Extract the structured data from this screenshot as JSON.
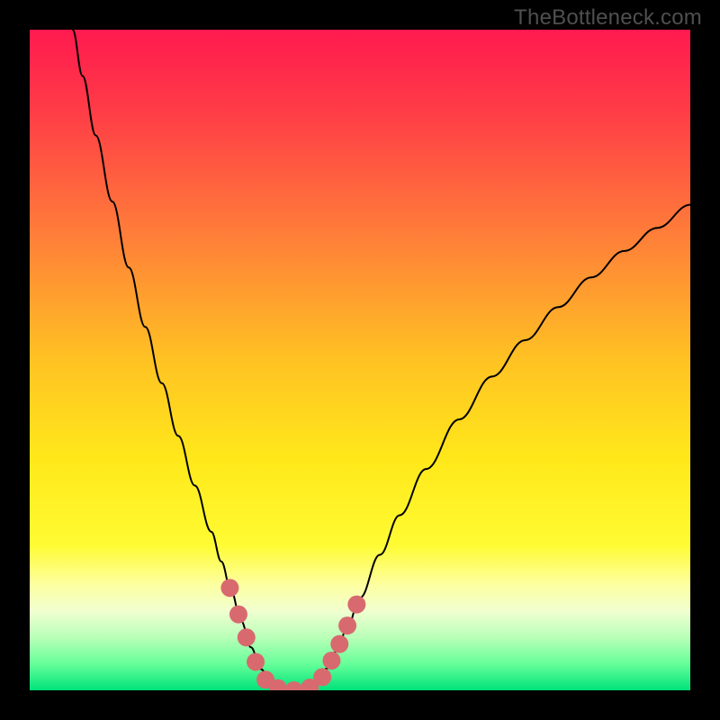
{
  "watermark": "TheBottleneck.com",
  "chart_data": {
    "type": "line",
    "title": "",
    "xlabel": "",
    "ylabel": "",
    "xlim": [
      0,
      100
    ],
    "ylim": [
      0,
      100
    ],
    "background_gradient": {
      "stops": [
        {
          "offset": 0.0,
          "color": "#ff1a4f"
        },
        {
          "offset": 0.12,
          "color": "#ff3b47"
        },
        {
          "offset": 0.3,
          "color": "#ff7a3a"
        },
        {
          "offset": 0.5,
          "color": "#ffc223"
        },
        {
          "offset": 0.65,
          "color": "#ffe81a"
        },
        {
          "offset": 0.78,
          "color": "#fffb33"
        },
        {
          "offset": 0.84,
          "color": "#fdffa0"
        },
        {
          "offset": 0.88,
          "color": "#f1ffd0"
        },
        {
          "offset": 0.92,
          "color": "#b8ffb8"
        },
        {
          "offset": 0.96,
          "color": "#66ff99"
        },
        {
          "offset": 1.0,
          "color": "#00e27a"
        }
      ]
    },
    "series": [
      {
        "name": "bottleneck-curve",
        "stroke": "#000000",
        "stroke_width": 2,
        "points": [
          {
            "x": 6.5,
            "y": 100.0
          },
          {
            "x": 8.0,
            "y": 93.0
          },
          {
            "x": 10.0,
            "y": 84.0
          },
          {
            "x": 12.5,
            "y": 74.0
          },
          {
            "x": 15.0,
            "y": 64.0
          },
          {
            "x": 17.5,
            "y": 55.0
          },
          {
            "x": 20.0,
            "y": 46.5
          },
          {
            "x": 22.5,
            "y": 38.5
          },
          {
            "x": 25.0,
            "y": 31.0
          },
          {
            "x": 27.5,
            "y": 24.0
          },
          {
            "x": 29.0,
            "y": 19.5
          },
          {
            "x": 30.5,
            "y": 15.0
          },
          {
            "x": 32.0,
            "y": 10.5
          },
          {
            "x": 33.5,
            "y": 6.5
          },
          {
            "x": 35.0,
            "y": 3.2
          },
          {
            "x": 36.5,
            "y": 1.2
          },
          {
            "x": 38.0,
            "y": 0.2
          },
          {
            "x": 40.0,
            "y": 0.0
          },
          {
            "x": 42.0,
            "y": 0.3
          },
          {
            "x": 43.5,
            "y": 1.3
          },
          {
            "x": 45.0,
            "y": 3.3
          },
          {
            "x": 46.5,
            "y": 6.0
          },
          {
            "x": 48.0,
            "y": 9.3
          },
          {
            "x": 50.0,
            "y": 14.0
          },
          {
            "x": 53.0,
            "y": 20.5
          },
          {
            "x": 56.0,
            "y": 26.5
          },
          {
            "x": 60.0,
            "y": 33.5
          },
          {
            "x": 65.0,
            "y": 41.0
          },
          {
            "x": 70.0,
            "y": 47.5
          },
          {
            "x": 75.0,
            "y": 53.0
          },
          {
            "x": 80.0,
            "y": 58.0
          },
          {
            "x": 85.0,
            "y": 62.5
          },
          {
            "x": 90.0,
            "y": 66.5
          },
          {
            "x": 95.0,
            "y": 70.0
          },
          {
            "x": 100.0,
            "y": 73.5
          }
        ]
      }
    ],
    "markers": {
      "color": "#d86a6f",
      "radius": 10,
      "points": [
        {
          "x": 30.3,
          "y": 15.5
        },
        {
          "x": 31.6,
          "y": 11.5
        },
        {
          "x": 32.8,
          "y": 8.0
        },
        {
          "x": 34.2,
          "y": 4.3
        },
        {
          "x": 35.7,
          "y": 1.6
        },
        {
          "x": 37.6,
          "y": 0.3
        },
        {
          "x": 40.0,
          "y": 0.0
        },
        {
          "x": 42.4,
          "y": 0.4
        },
        {
          "x": 44.3,
          "y": 2.0
        },
        {
          "x": 45.7,
          "y": 4.5
        },
        {
          "x": 46.9,
          "y": 7.0
        },
        {
          "x": 48.1,
          "y": 9.8
        },
        {
          "x": 49.5,
          "y": 13.0
        }
      ]
    }
  }
}
